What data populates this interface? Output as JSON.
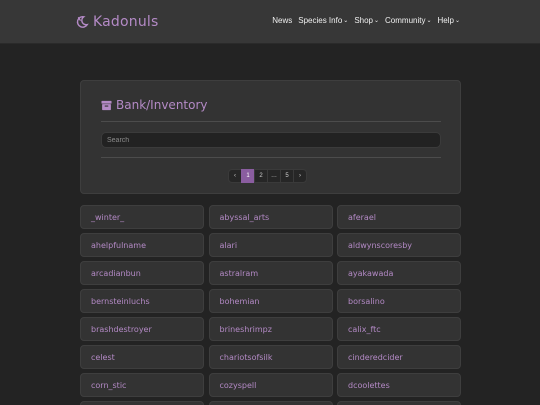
{
  "brand": {
    "name": "Kadonuls",
    "icon": "moon-icon"
  },
  "nav": [
    {
      "label": "News",
      "dropdown": false
    },
    {
      "label": "Species Info",
      "dropdown": true
    },
    {
      "label": "Shop",
      "dropdown": true
    },
    {
      "label": "Community",
      "dropdown": true
    },
    {
      "label": "Help",
      "dropdown": true
    }
  ],
  "panel": {
    "title": "Bank/Inventory",
    "icon": "archive-box-icon",
    "search_placeholder": "Search"
  },
  "pagination": {
    "prev": "‹",
    "next": "›",
    "pages": [
      "1",
      "2",
      "…",
      "5"
    ],
    "current": "1"
  },
  "users": [
    "_winter_",
    "abyssal_arts",
    "aferael",
    "ahelpfulname",
    "alari",
    "aldwynscoresby",
    "arcadianbun",
    "astralram",
    "ayakawada",
    "bernsteinluchs",
    "bohemian",
    "borsalino",
    "brashdestroyer",
    "brineshrimpz",
    "calix_ftc",
    "celest",
    "chariotsofsilk",
    "cinderedcider",
    "corn_stic",
    "cozyspell",
    "dcoolettes",
    "",
    "",
    ""
  ],
  "colors": {
    "accent": "#b48ac6",
    "active_page": "#8a5da0",
    "background": "#232323",
    "card": "#333333",
    "navbar": "#373737"
  }
}
